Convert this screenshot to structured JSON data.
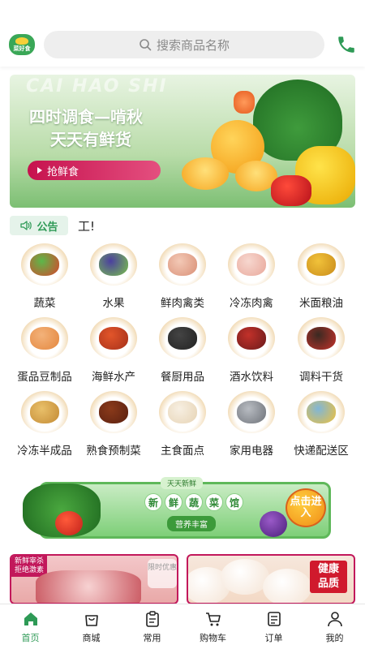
{
  "header": {
    "logo_text": "菜好食",
    "search_placeholder": "搜索商品名称"
  },
  "banner": {
    "watermark": "CAI HAO SHI",
    "line1": "四时调食—啃秋",
    "line2": "天天有鲜货",
    "cta_label": "抢鲜食"
  },
  "notice": {
    "tag": "公告",
    "text": "工!"
  },
  "categories": [
    {
      "label": "蔬菜",
      "icon": "vegetables-icon"
    },
    {
      "label": "水果",
      "icon": "fruit-icon"
    },
    {
      "label": "鲜肉禽类",
      "icon": "fresh-meat-icon"
    },
    {
      "label": "冷冻肉禽",
      "icon": "frozen-meat-icon"
    },
    {
      "label": "米面粮油",
      "icon": "grain-oil-icon"
    },
    {
      "label": "蛋品豆制品",
      "icon": "egg-icon"
    },
    {
      "label": "海鲜水产",
      "icon": "seafood-icon"
    },
    {
      "label": "餐厨用品",
      "icon": "kitchenware-icon"
    },
    {
      "label": "酒水饮料",
      "icon": "drinks-icon"
    },
    {
      "label": "调料干货",
      "icon": "seasoning-icon"
    },
    {
      "label": "冷冻半成品",
      "icon": "frozen-semi-icon"
    },
    {
      "label": "熟食预制菜",
      "icon": "cooked-food-icon"
    },
    {
      "label": "主食面点",
      "icon": "staple-food-icon"
    },
    {
      "label": "家用电器",
      "icon": "appliance-icon"
    },
    {
      "label": "快递配送区",
      "icon": "delivery-icon"
    }
  ],
  "promo": {
    "top": "天天新鲜",
    "chars": [
      "新",
      "鲜",
      "蔬",
      "菜",
      "馆"
    ],
    "sub": "营养丰富",
    "go": "点击进入"
  },
  "cards": {
    "left_tag_line1": "新鲜宰杀",
    "left_tag_line2": "拒绝激素",
    "left_badge": "限时优惠",
    "right_badge_line1": "健康",
    "right_badge_line2": "品质"
  },
  "tabs": [
    {
      "label": "首页",
      "icon": "home-icon",
      "active": true
    },
    {
      "label": "商城",
      "icon": "shopping-bag-icon",
      "active": false
    },
    {
      "label": "常用",
      "icon": "clipboard-icon",
      "active": false
    },
    {
      "label": "购物车",
      "icon": "cart-icon",
      "active": false
    },
    {
      "label": "订单",
      "icon": "order-list-icon",
      "active": false
    },
    {
      "label": "我的",
      "icon": "user-icon",
      "active": false
    }
  ],
  "colors": {
    "brand_green": "#2e9a56",
    "accent_red": "#c2185b"
  }
}
